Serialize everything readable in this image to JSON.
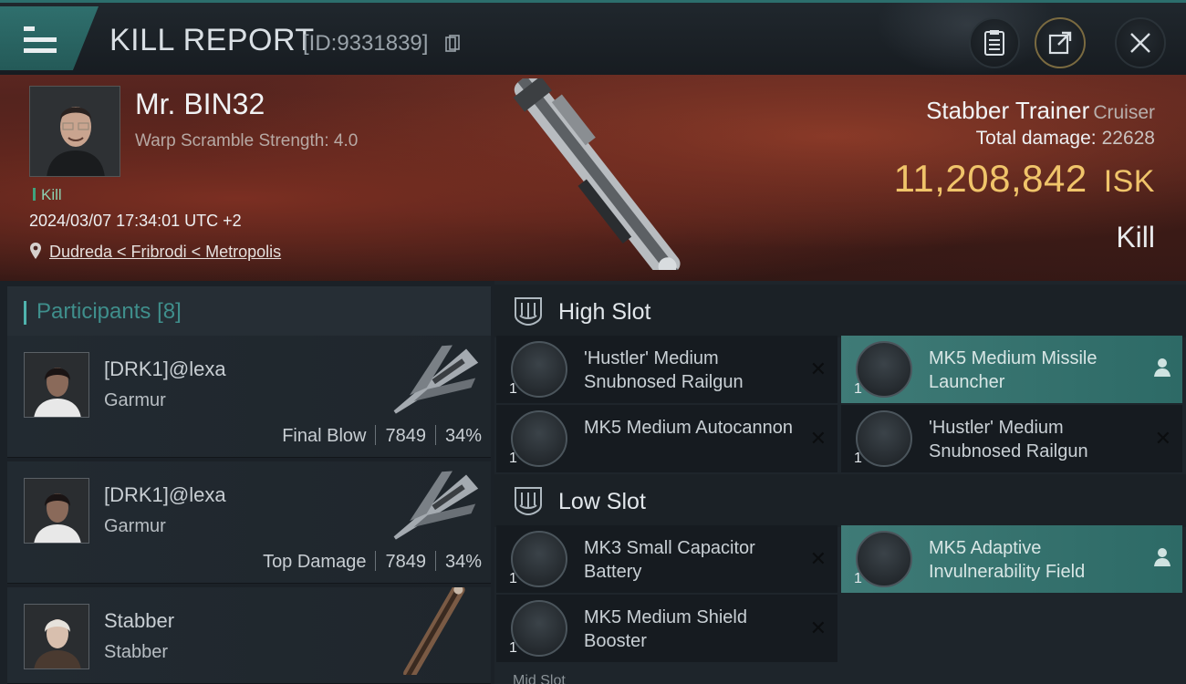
{
  "header": {
    "title": "KILL REPORT",
    "report_id": "[ID:9331839]",
    "buttons": [
      "clipboard-icon",
      "export-icon",
      "close-icon"
    ]
  },
  "victim": {
    "name": "Mr. BIN32",
    "warp_scramble": "Warp Scramble Strength: 4.0",
    "tag": "Kill",
    "datetime": "2024/03/07 17:34:01 UTC +2",
    "location": "Dudreda < Fribrodi < Metropolis",
    "ship": "Stabber Trainer",
    "ship_class": "Cruiser",
    "total_damage_label": "Total damage:",
    "total_damage": "22628",
    "isk_value": "11,208,842",
    "isk_unit": "ISK",
    "result": "Kill"
  },
  "participants": {
    "title": "Participants",
    "count": "[8]",
    "list": [
      {
        "name": "[DRK1]@lexa",
        "ship": "Garmur",
        "role": "Final Blow",
        "damage": "7849",
        "percent": "34%"
      },
      {
        "name": "[DRK1]@lexa",
        "ship": "Garmur",
        "role": "Top Damage",
        "damage": "7849",
        "percent": "34%"
      },
      {
        "name": "Stabber",
        "ship": "Stabber",
        "role": "",
        "damage": "",
        "percent": ""
      }
    ]
  },
  "slots": {
    "high": {
      "label": "High Slot",
      "modules": [
        {
          "name": "'Hustler' Medium Snubnosed Railgun",
          "qty": "1",
          "highlight": false
        },
        {
          "name": "MK5 Medium Missile Launcher",
          "qty": "1",
          "highlight": true
        },
        {
          "name": "MK5 Medium Autocannon",
          "qty": "1",
          "highlight": false
        },
        {
          "name": "'Hustler' Medium Snubnosed Railgun",
          "qty": "1",
          "highlight": false
        }
      ]
    },
    "low": {
      "label": "Low Slot",
      "modules": [
        {
          "name": "MK3 Small Capacitor Battery",
          "qty": "1",
          "highlight": false
        },
        {
          "name": "MK5 Adaptive Invulnerability Field",
          "qty": "1",
          "highlight": true
        },
        {
          "name": "MK5 Medium Shield Booster",
          "qty": "1",
          "highlight": false
        }
      ]
    },
    "next_label": "Mid Slot"
  },
  "colors": {
    "accent_teal": "#2c6e6c",
    "isk_gold": "#f0c46a",
    "kill_green": "#3fa37c"
  }
}
